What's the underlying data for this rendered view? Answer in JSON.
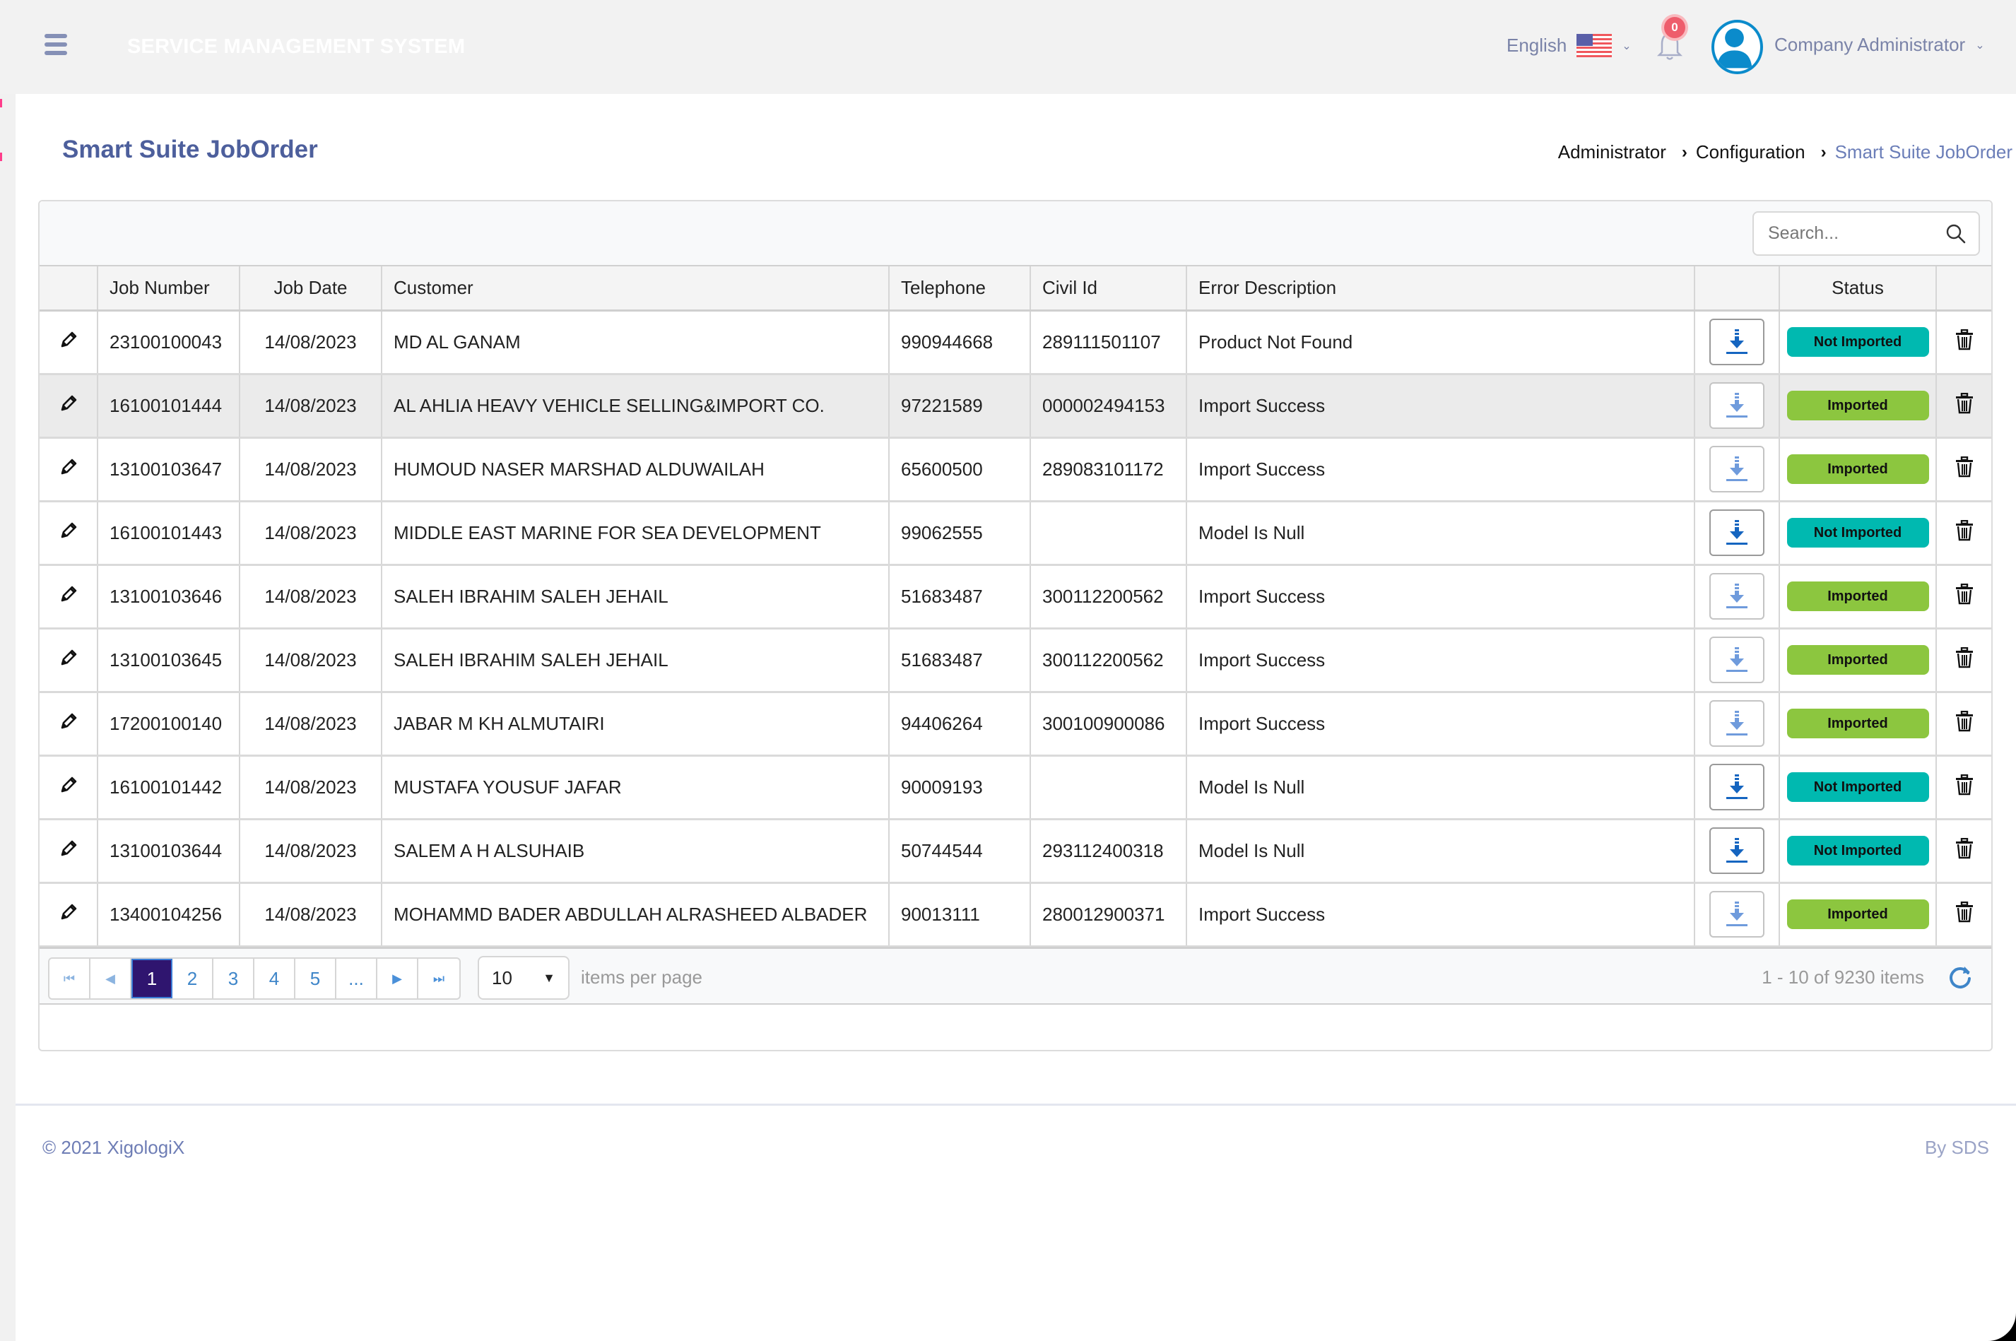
{
  "header": {
    "app_title": "SERVICE MANAGEMENT SYSTEM",
    "language": "English",
    "notification_count": "0",
    "user_name": "Company Administrator"
  },
  "page": {
    "title": "Smart Suite JobOrder",
    "breadcrumb": [
      "Administrator",
      "Configuration",
      "Smart Suite JobOrder"
    ]
  },
  "search": {
    "placeholder": "Search...",
    "value": ""
  },
  "table": {
    "columns": [
      "",
      "Job Number",
      "Job Date",
      "Customer",
      "Telephone",
      "Civil Id",
      "Error Description",
      "",
      "Status",
      ""
    ],
    "rows": [
      {
        "job_number": "23100100043",
        "job_date": "14/08/2023",
        "customer": "MD AL GANAM",
        "telephone": "990944668",
        "civil_id": "289111501107",
        "error": "Product Not Found",
        "status": "Not Imported"
      },
      {
        "job_number": "16100101444",
        "job_date": "14/08/2023",
        "customer": "AL AHLIA HEAVY VEHICLE SELLING&IMPORT CO.",
        "telephone": "97221589",
        "civil_id": "000002494153",
        "error": "Import Success",
        "status": "Imported"
      },
      {
        "job_number": "13100103647",
        "job_date": "14/08/2023",
        "customer": "HUMOUD NASER MARSHAD ALDUWAILAH",
        "telephone": "65600500",
        "civil_id": "289083101172",
        "error": "Import Success",
        "status": "Imported"
      },
      {
        "job_number": "16100101443",
        "job_date": "14/08/2023",
        "customer": "MIDDLE EAST MARINE FOR SEA DEVELOPMENT",
        "telephone": "99062555",
        "civil_id": "",
        "error": "Model Is Null",
        "status": "Not Imported"
      },
      {
        "job_number": "13100103646",
        "job_date": "14/08/2023",
        "customer": "SALEH IBRAHIM SALEH JEHAIL",
        "telephone": "51683487",
        "civil_id": "300112200562",
        "error": "Import Success",
        "status": "Imported"
      },
      {
        "job_number": "13100103645",
        "job_date": "14/08/2023",
        "customer": "SALEH IBRAHIM SALEH JEHAIL",
        "telephone": "51683487",
        "civil_id": "300112200562",
        "error": "Import Success",
        "status": "Imported"
      },
      {
        "job_number": "17200100140",
        "job_date": "14/08/2023",
        "customer": "JABAR M KH ALMUTAIRI",
        "telephone": "94406264",
        "civil_id": "300100900086",
        "error": "Import Success",
        "status": "Imported"
      },
      {
        "job_number": "16100101442",
        "job_date": "14/08/2023",
        "customer": "MUSTAFA YOUSUF JAFAR",
        "telephone": "90009193",
        "civil_id": "",
        "error": "Model Is Null",
        "status": "Not Imported"
      },
      {
        "job_number": "13100103644",
        "job_date": "14/08/2023",
        "customer": "SALEM A H ALSUHAIB",
        "telephone": "50744544",
        "civil_id": "293112400318",
        "error": "Model Is Null",
        "status": "Not Imported"
      },
      {
        "job_number": "13400104256",
        "job_date": "14/08/2023",
        "customer": "MOHAMMD BADER ABDULLAH ALRASHEED ALBADER",
        "telephone": "90013111",
        "civil_id": "280012900371",
        "error": "Import Success",
        "status": "Imported"
      }
    ],
    "highlighted_row": 1
  },
  "pager": {
    "pages": [
      "1",
      "2",
      "3",
      "4",
      "5",
      "..."
    ],
    "current_page": "1",
    "page_size": "10",
    "page_size_label": "items per page",
    "range_info": "1 - 10 of 9230 items"
  },
  "footer": {
    "copyright": "© 2021 XigologiX",
    "credit": "By SDS"
  },
  "colors": {
    "brand_title": "#4d5f9c",
    "not_imported": "#00b9b0",
    "imported": "#8cc63f",
    "active_page": "#2f156f",
    "badge": "#ee5d6c"
  }
}
